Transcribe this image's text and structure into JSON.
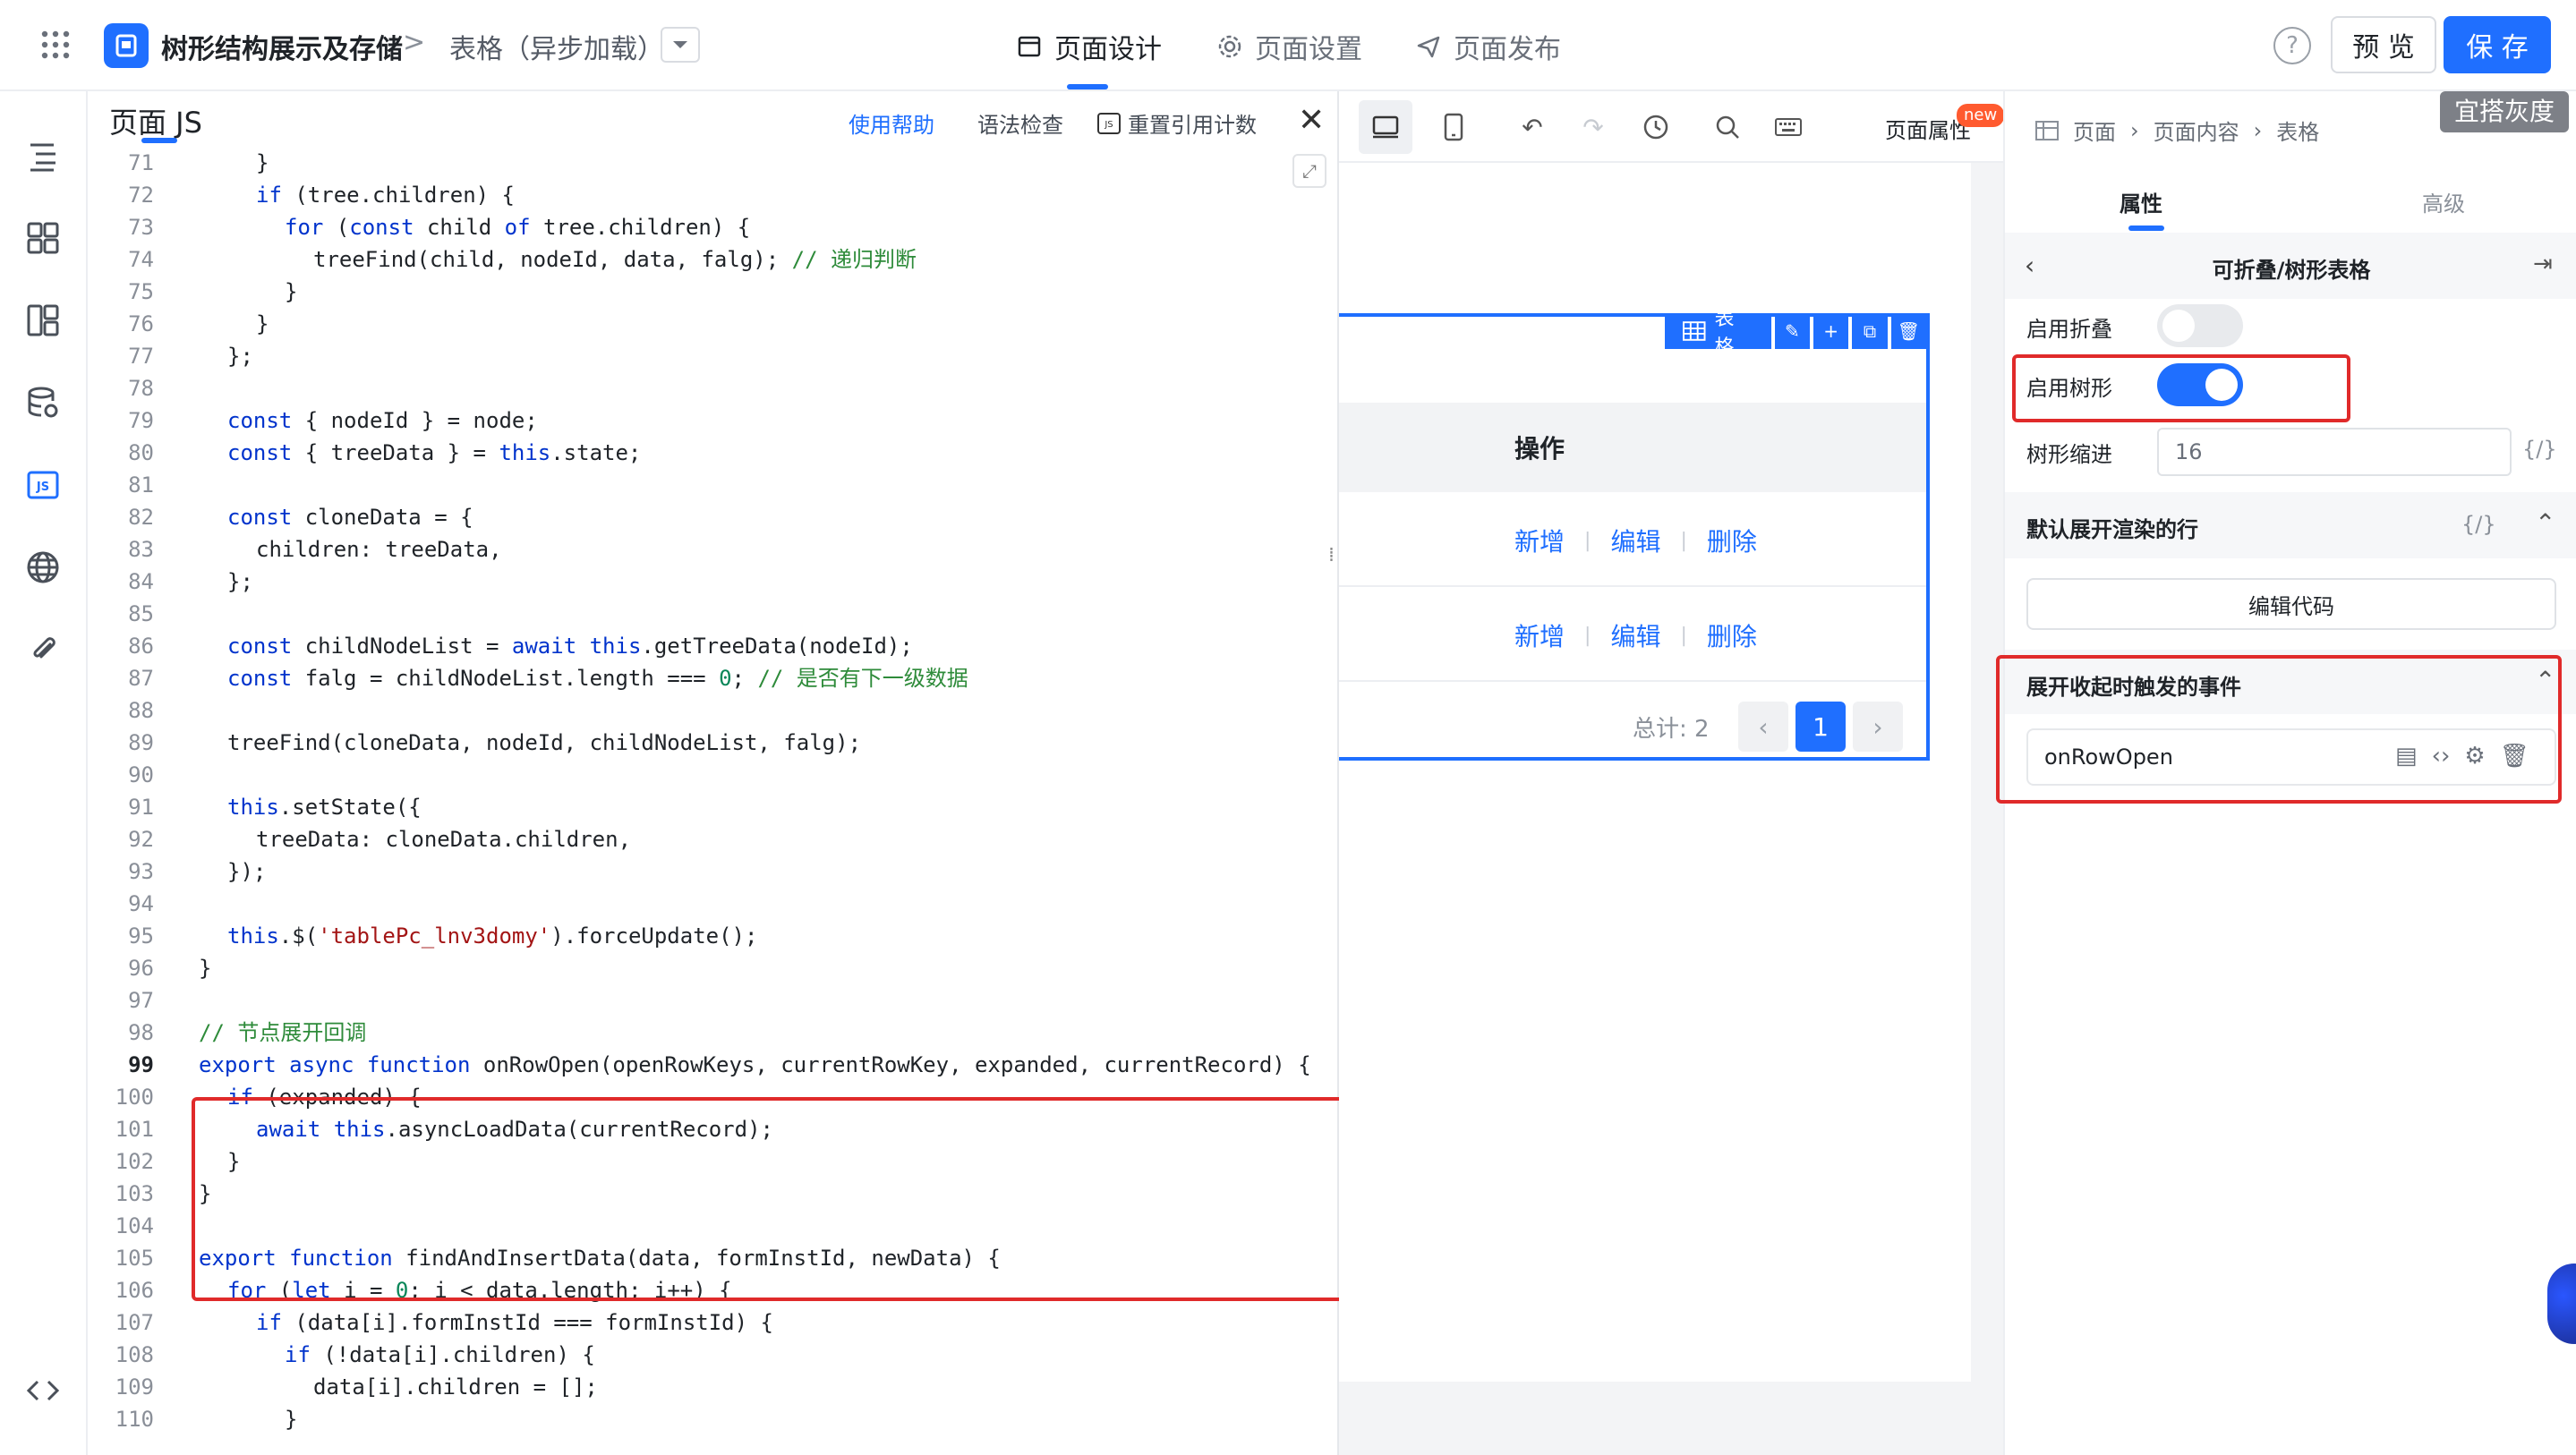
{
  "topbar": {
    "app_title": "树形结构展示及存储",
    "breadcrumb_sep": ">",
    "page_name": "表格（异步加载）",
    "tabs": [
      {
        "label": "页面设计",
        "icon": "window-icon"
      },
      {
        "label": "页面设置",
        "icon": "gear-icon"
      },
      {
        "label": "页面发布",
        "icon": "send-icon"
      }
    ],
    "preview_label": "预 览",
    "save_label": "保 存",
    "help_glyph": "?"
  },
  "code_panel": {
    "title": "页面 JS",
    "actions": {
      "help": "使用帮助",
      "lint": "语法检查",
      "reset": "重置引用计数"
    },
    "lines": [
      {
        "n": "71",
        "indent": 2,
        "code": "}"
      },
      {
        "n": "72",
        "indent": 2,
        "code": "if (tree.children) {"
      },
      {
        "n": "73",
        "indent": 3,
        "code": "for (const child of tree.children) {"
      },
      {
        "n": "74",
        "indent": 4,
        "code": "treeFind(child, nodeId, data, falg); // 递归判断"
      },
      {
        "n": "75",
        "indent": 3,
        "code": "}"
      },
      {
        "n": "76",
        "indent": 2,
        "code": "}"
      },
      {
        "n": "77",
        "indent": 1,
        "code": "};"
      },
      {
        "n": "78",
        "indent": 0,
        "code": ""
      },
      {
        "n": "79",
        "indent": 1,
        "code": "const { nodeId } = node;"
      },
      {
        "n": "80",
        "indent": 1,
        "code": "const { treeData } = this.state;"
      },
      {
        "n": "81",
        "indent": 0,
        "code": ""
      },
      {
        "n": "82",
        "indent": 1,
        "code": "const cloneData = {"
      },
      {
        "n": "83",
        "indent": 2,
        "code": "children: treeData,"
      },
      {
        "n": "84",
        "indent": 1,
        "code": "};"
      },
      {
        "n": "85",
        "indent": 0,
        "code": ""
      },
      {
        "n": "86",
        "indent": 1,
        "code": "const childNodeList = await this.getTreeData(nodeId);"
      },
      {
        "n": "87",
        "indent": 1,
        "code": "const falg = childNodeList.length === 0; // 是否有下一级数据"
      },
      {
        "n": "88",
        "indent": 0,
        "code": ""
      },
      {
        "n": "89",
        "indent": 1,
        "code": "treeFind(cloneData, nodeId, childNodeList, falg);"
      },
      {
        "n": "90",
        "indent": 0,
        "code": ""
      },
      {
        "n": "91",
        "indent": 1,
        "code": "this.setState({"
      },
      {
        "n": "92",
        "indent": 2,
        "code": "treeData: cloneData.children,"
      },
      {
        "n": "93",
        "indent": 1,
        "code": "});"
      },
      {
        "n": "94",
        "indent": 0,
        "code": ""
      },
      {
        "n": "95",
        "indent": 1,
        "code": "this.$('tablePc_lnv3domy').forceUpdate();"
      },
      {
        "n": "96",
        "indent": 0,
        "code": "}"
      },
      {
        "n": "97",
        "indent": 0,
        "code": ""
      },
      {
        "n": "98",
        "indent": 0,
        "code": "// 节点展开回调"
      },
      {
        "n": "99",
        "indent": 0,
        "code": "export async function onRowOpen(openRowKeys, currentRowKey, expanded, currentRecord) {"
      },
      {
        "n": "100",
        "indent": 1,
        "code": "if (expanded) {"
      },
      {
        "n": "101",
        "indent": 2,
        "code": "await this.asyncLoadData(currentRecord);"
      },
      {
        "n": "102",
        "indent": 1,
        "code": "}"
      },
      {
        "n": "103",
        "indent": 0,
        "code": "}"
      },
      {
        "n": "104",
        "indent": 0,
        "code": ""
      },
      {
        "n": "105",
        "indent": 0,
        "code": "export function findAndInsertData(data, formInstId, newData) {"
      },
      {
        "n": "106",
        "indent": 1,
        "code": "for (let i = 0; i < data.length; i++) {"
      },
      {
        "n": "107",
        "indent": 2,
        "code": "if (data[i].formInstId === formInstId) {"
      },
      {
        "n": "108",
        "indent": 3,
        "code": "if (!data[i].children) {"
      },
      {
        "n": "109",
        "indent": 4,
        "code": "data[i].children = [];"
      },
      {
        "n": "110",
        "indent": 3,
        "code": "}"
      }
    ],
    "current_line": "99"
  },
  "canvas": {
    "page_props_label": "页面属性",
    "new_badge": "new",
    "table_toolbar_label": "表格",
    "column_header": "操作",
    "rows": [
      {
        "actions": [
          "新增",
          "编辑",
          "删除"
        ]
      },
      {
        "actions": [
          "新增",
          "编辑",
          "删除"
        ]
      }
    ],
    "total_text": "总计: 2",
    "current_page": "1"
  },
  "right_panel": {
    "breadcrumb": [
      "页面",
      "页面内容",
      "表格"
    ],
    "gray_tag": "宜搭灰度",
    "tabs": [
      "属性",
      "高级"
    ],
    "component_name": "可折叠/树形表格",
    "props": {
      "collapse_label": "启用折叠",
      "collapse_on": false,
      "tree_label": "启用树形",
      "tree_on": true,
      "indent_label": "树形缩进",
      "indent_value": "16",
      "fx_glyph": "{/}"
    },
    "default_expand_title": "默认展开渲染的行",
    "edit_code_label": "编辑代码",
    "event_section_title": "展开收起时触发的事件",
    "event_name": "onRowOpen"
  },
  "colors": {
    "accent": "#1f6fff",
    "highlight_red": "#e02a2a",
    "comment_green": "#2e8b3a",
    "keyword_blue": "#0033cc"
  }
}
